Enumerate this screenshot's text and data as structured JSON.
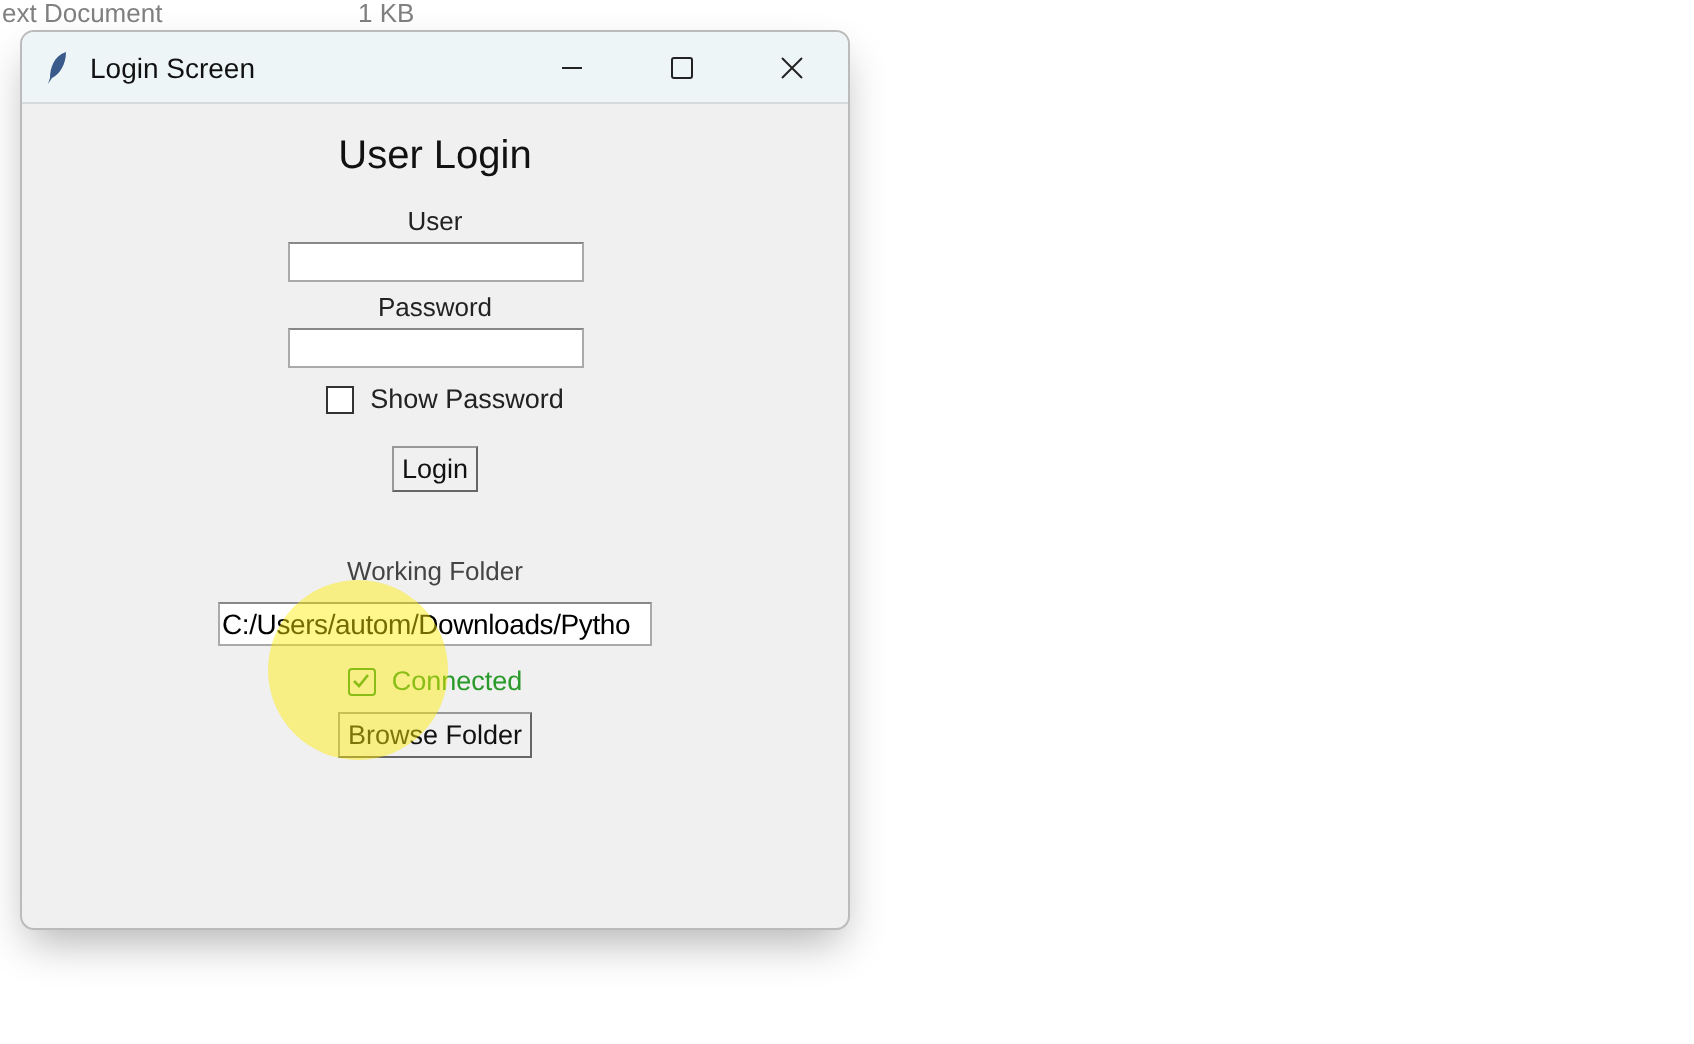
{
  "background_list": [
    {
      "name": "ext Document",
      "size": "1 KB"
    }
  ],
  "window": {
    "title": "Login Screen"
  },
  "heading": "User Login",
  "user": {
    "label": "User"
  },
  "password": {
    "label": "Password"
  },
  "show_password": {
    "label": "Show Password",
    "checked": false
  },
  "login_button": "Login",
  "folder": {
    "label": "Working Folder",
    "value": "C:/Users/autom/Downloads/Pytho"
  },
  "connected": {
    "label": "Connected",
    "checked": true
  },
  "browse_button": "Browse Folder"
}
